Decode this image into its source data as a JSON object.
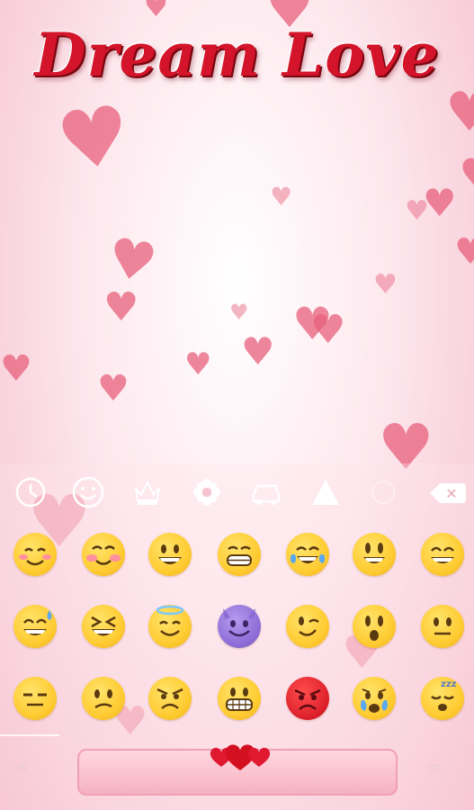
{
  "title": "Dream Love",
  "colors": {
    "title": "#d4142a",
    "heart": "#e8607c",
    "background": "#fde8ee"
  },
  "toolbar": {
    "icons": [
      "clock-icon",
      "smiley-icon",
      "crown-icon",
      "flower-icon",
      "car-icon",
      "triangle-icon",
      "blank-icon"
    ],
    "backspace_symbol": "✕"
  },
  "emoji_rows": [
    [
      "smiling-blush",
      "blushing-face",
      "grinning-face",
      "grimacing-grin",
      "tears-of-joy",
      "big-smile",
      "beaming-face"
    ],
    [
      "sweat-smile",
      "squinting-laugh",
      "halo-face",
      "smiling-devil",
      "winking-face",
      "hushed-face",
      "neutral-face"
    ],
    [
      "expressionless-face",
      "confused-face",
      "angry-face",
      "grimacing-face",
      "pouting-face",
      "crying-face",
      "sleeping-face"
    ]
  ],
  "side_keys": {
    "left": "⌨",
    "right": "⌨"
  }
}
